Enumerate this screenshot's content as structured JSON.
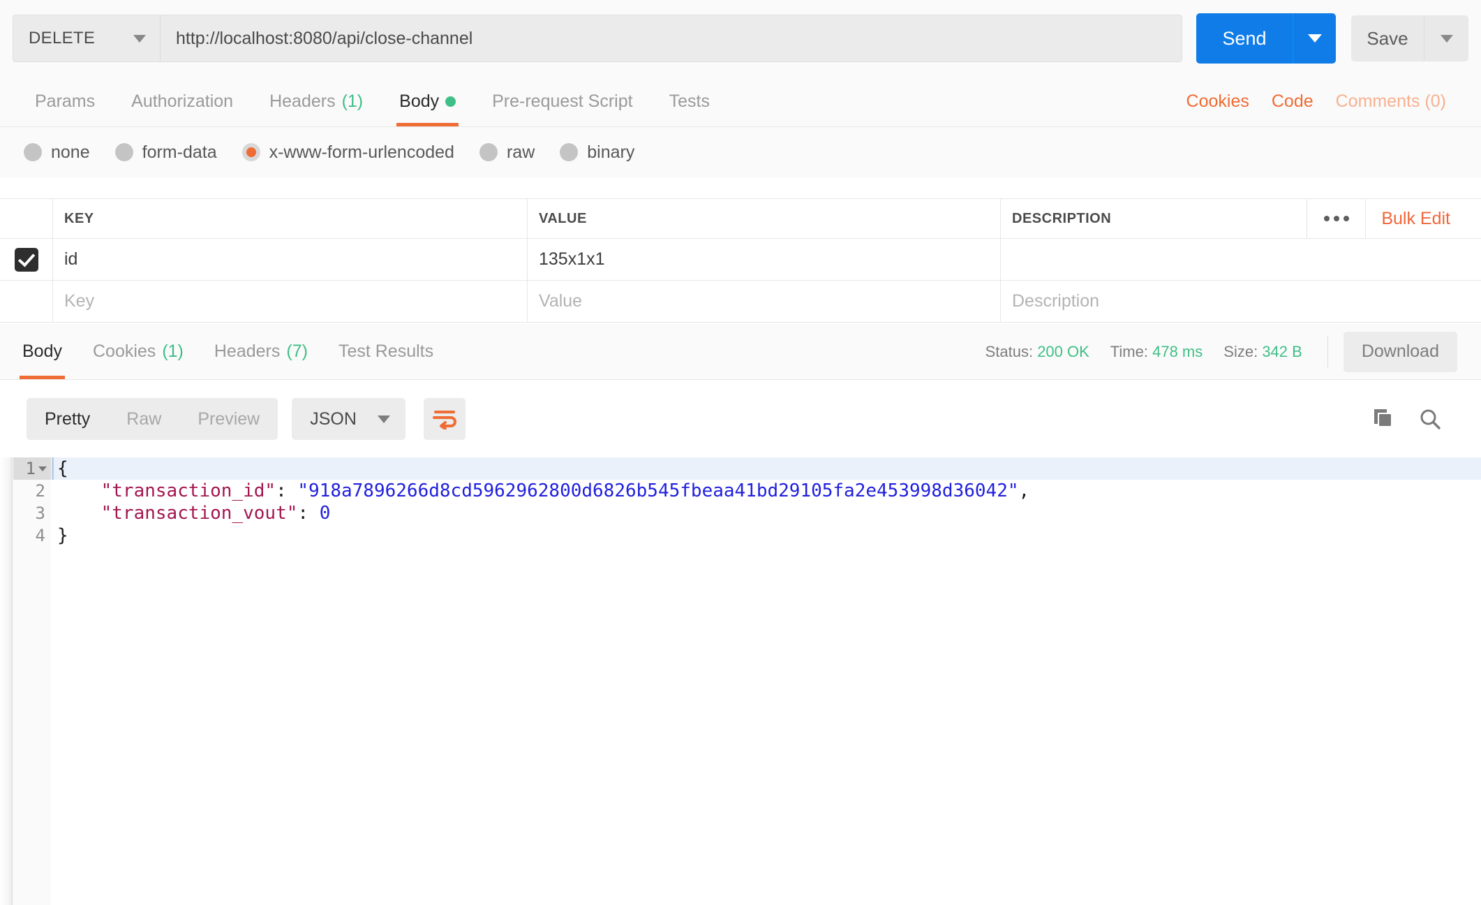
{
  "urlbar": {
    "method": "DELETE",
    "url": "http://localhost:8080/api/close-channel",
    "send_label": "Send",
    "save_label": "Save"
  },
  "request_tabs": {
    "items": [
      {
        "label": "Params",
        "count": "",
        "active": false,
        "dot": false
      },
      {
        "label": "Authorization",
        "count": "",
        "active": false,
        "dot": false
      },
      {
        "label": "Headers",
        "count": "(1)",
        "active": false,
        "dot": false
      },
      {
        "label": "Body",
        "count": "",
        "active": true,
        "dot": true
      },
      {
        "label": "Pre-request Script",
        "count": "",
        "active": false,
        "dot": false
      },
      {
        "label": "Tests",
        "count": "",
        "active": false,
        "dot": false
      }
    ],
    "cookies_label": "Cookies",
    "code_label": "Code",
    "comments_label": "Comments (0)"
  },
  "body_types": [
    {
      "label": "none",
      "checked": false
    },
    {
      "label": "form-data",
      "checked": false
    },
    {
      "label": "x-www-form-urlencoded",
      "checked": true
    },
    {
      "label": "raw",
      "checked": false
    },
    {
      "label": "binary",
      "checked": false
    }
  ],
  "kv_table": {
    "headers": {
      "key": "KEY",
      "value": "VALUE",
      "description": "DESCRIPTION"
    },
    "bulk_edit_label": "Bulk Edit",
    "rows": [
      {
        "checked": true,
        "key": "id",
        "value": "135x1x1",
        "description": ""
      }
    ],
    "new_row": {
      "key_placeholder": "Key",
      "value_placeholder": "Value",
      "description_placeholder": "Description"
    }
  },
  "response_tabs": {
    "items": [
      {
        "label": "Body",
        "count": "",
        "active": true
      },
      {
        "label": "Cookies",
        "count": "(1)",
        "active": false
      },
      {
        "label": "Headers",
        "count": "(7)",
        "active": false
      },
      {
        "label": "Test Results",
        "count": "",
        "active": false
      }
    ],
    "status_label": "Status:",
    "status_value": "200 OK",
    "time_label": "Time:",
    "time_value": "478 ms",
    "size_label": "Size:",
    "size_value": "342 B",
    "download_label": "Download"
  },
  "view_toolbar": {
    "modes": [
      {
        "label": "Pretty",
        "active": true
      },
      {
        "label": "Raw",
        "active": false
      },
      {
        "label": "Preview",
        "active": false
      }
    ],
    "language": "JSON",
    "wrap_icon": "word-wrap-icon",
    "copy_icon": "copy-icon",
    "search_icon": "search-icon"
  },
  "response_body": {
    "language": "json",
    "lines": [
      {
        "num": "1",
        "folded": true,
        "tokens": [
          {
            "t": "punc",
            "v": "{"
          }
        ]
      },
      {
        "num": "2",
        "folded": false,
        "tokens": [
          {
            "t": "plain",
            "v": "    "
          },
          {
            "t": "key",
            "v": "\"transaction_id\""
          },
          {
            "t": "punc",
            "v": ": "
          },
          {
            "t": "str",
            "v": "\"918a7896266d8cd5962962800d6826b545fbeaa41bd29105fa2e453998d36042\""
          },
          {
            "t": "punc",
            "v": ","
          }
        ]
      },
      {
        "num": "3",
        "folded": false,
        "tokens": [
          {
            "t": "plain",
            "v": "    "
          },
          {
            "t": "key",
            "v": "\"transaction_vout\""
          },
          {
            "t": "punc",
            "v": ": "
          },
          {
            "t": "num",
            "v": "0"
          }
        ]
      },
      {
        "num": "4",
        "folded": false,
        "tokens": [
          {
            "t": "punc",
            "v": "}"
          }
        ]
      }
    ]
  },
  "colors": {
    "accent_orange": "#ef6c34",
    "send_blue": "#0f7ce8",
    "success_green": "#3fbf86",
    "string_blue": "#2020dd",
    "key_magenta": "#a3174f"
  }
}
